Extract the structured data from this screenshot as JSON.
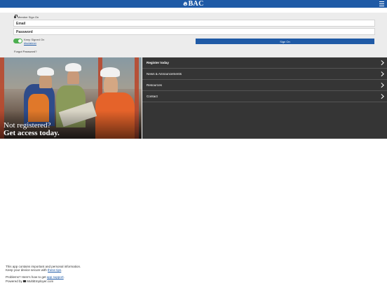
{
  "header": {
    "logo_text": "BAC",
    "logo_icon": "torch-icon",
    "menu_icon": "hamburger-icon",
    "brand_color": "#1f5aa6"
  },
  "signin": {
    "title": "Member Sign On",
    "email_placeholder": "Email",
    "password_placeholder": "Password",
    "keep_signed_on_label": "Keep Signed On",
    "keep_signed_on_state": "on",
    "disclaimer_link": "disclaimer",
    "signon_button": "Sign On",
    "forgot_password": "Forgot Password?"
  },
  "hero": {
    "line1": "Not registered?",
    "line2": "Get access today."
  },
  "nav": {
    "items": [
      {
        "label": "Register today"
      },
      {
        "label": "News & Announcements"
      },
      {
        "label": "Resources"
      },
      {
        "label": "Contact"
      }
    ]
  },
  "footer": {
    "line1": "This app contains important and personal information.",
    "line2_prefix": "Keep your device secure with",
    "line2_link": "these tips",
    "line2_suffix": ".",
    "line3_prefix": "Problems? Here's how to get",
    "line3_link": "app support",
    "line3_suffix": ".",
    "powered_prefix": "Powered by",
    "powered_brand": "MultiEmployer.com"
  }
}
